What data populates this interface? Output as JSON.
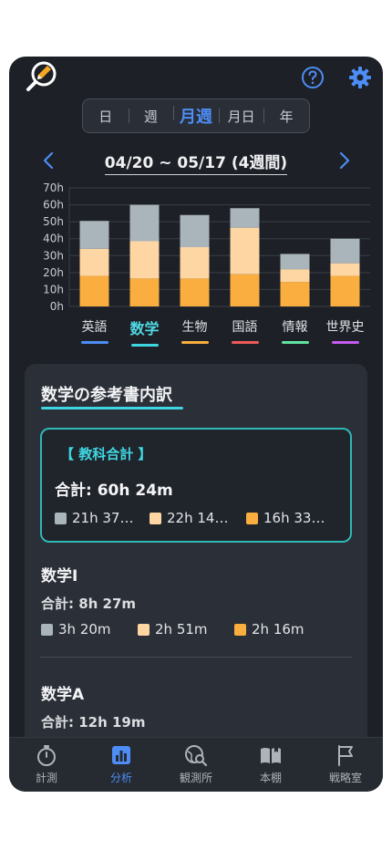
{
  "period_tabs": [
    {
      "label": "日"
    },
    {
      "label": "週"
    },
    {
      "label": "月週"
    },
    {
      "label": "月日"
    },
    {
      "label": "年"
    }
  ],
  "active_period": "月週",
  "date_range": "04/20 ~ 05/17 (4週間)",
  "icons": {
    "logo": "magnifier-pen-logo-icon",
    "help": "question-circle-icon",
    "settings": "gear-icon",
    "prev": "chevron-left-icon",
    "next": "chevron-right-icon"
  },
  "colors": {
    "accent_blue": "#4d8df5",
    "accent_cyan": "#3fd6e3",
    "series_gray": "#aab4bb",
    "series_light_orange": "#fdd6a4",
    "series_orange": "#f9ae3f"
  },
  "chart_data": {
    "type": "bar",
    "stacked": true,
    "categories": [
      "英語",
      "数学",
      "生物",
      "国語",
      "情報",
      "世界史"
    ],
    "series": [
      {
        "color": "#f9ae3f",
        "values": [
          18,
          16.5,
          16.5,
          19,
          14.5,
          18
        ]
      },
      {
        "color": "#fdd6a4",
        "values": [
          16,
          22,
          18.5,
          27.5,
          7.5,
          7.5
        ]
      },
      {
        "color": "#aab4bb",
        "values": [
          16.5,
          21.5,
          19,
          11.5,
          9,
          14.5
        ]
      }
    ],
    "ylim": [
      0,
      70
    ],
    "yticks": [
      "0h",
      "10h",
      "20h",
      "30h",
      "40h",
      "50h",
      "60h",
      "70h"
    ],
    "grid": true,
    "subject_underline_colors": [
      "#4d8df5",
      "#3fd6e3",
      "#f9ae3f",
      "#ee5a5a",
      "#5fe3a0",
      "#c65bf0"
    ]
  },
  "active_subject": "数学",
  "breakdown": {
    "title": "数学の参考書内訳",
    "summary": {
      "label": "【 教科合計 】",
      "total": "合計: 60h 24m",
      "items": [
        "21h 37…",
        "22h 14…",
        "16h 33…"
      ]
    },
    "books": [
      {
        "title": "数学I",
        "total": "合計: 8h 27m",
        "items": [
          "3h 20m",
          "2h 51m",
          "2h 16m"
        ]
      },
      {
        "title": "数学A",
        "total": "合計: 12h 19m"
      }
    ]
  },
  "tabbar": [
    {
      "label": "計測",
      "icon": "stopwatch-icon"
    },
    {
      "label": "分析",
      "icon": "bar-chart-icon"
    },
    {
      "label": "観測所",
      "icon": "globe-search-icon"
    },
    {
      "label": "本棚",
      "icon": "open-book-icon"
    },
    {
      "label": "戦略室",
      "icon": "flag-icon"
    }
  ],
  "active_tab": "分析"
}
